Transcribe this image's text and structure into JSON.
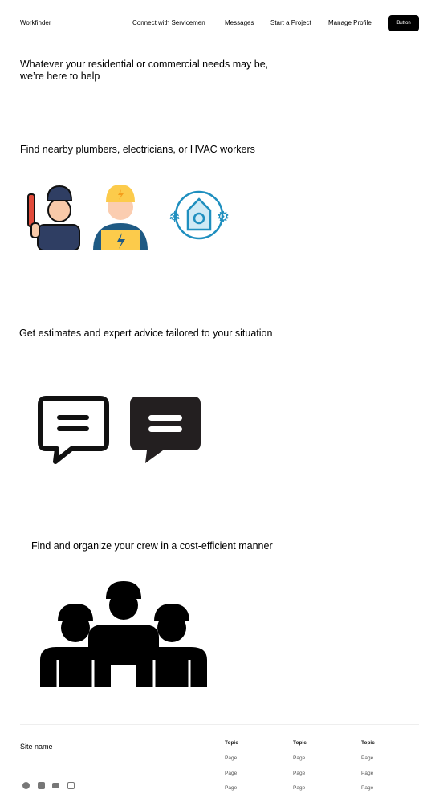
{
  "header": {
    "brand": "Workfinder",
    "nav": [
      "Connect with Servicemen",
      "Messages",
      "Start a Project",
      "Manage Profile"
    ],
    "button_label": "Button"
  },
  "hero": {
    "line1": "Whatever your residential or commercial needs may be,",
    "line2": "we’re here to help"
  },
  "sections": [
    {
      "title": "Find nearby plumbers, electricians, or HVAC workers",
      "icons": [
        "plumber-icon",
        "electrician-icon",
        "hvac-icon"
      ]
    },
    {
      "title": "Get estimates and expert advice tailored to your situation",
      "icons": [
        "chat-bubble-outline-icon",
        "chat-bubble-filled-icon"
      ]
    },
    {
      "title": "Find and organize your crew in a cost-efficient manner",
      "icons": [
        "crew-icon"
      ]
    }
  ],
  "footer": {
    "site_name": "Site name",
    "columns": [
      {
        "topic": "Topic",
        "pages": [
          "Page",
          "Page",
          "Page"
        ]
      },
      {
        "topic": "Topic",
        "pages": [
          "Page",
          "Page",
          "Page"
        ]
      },
      {
        "topic": "Topic",
        "pages": [
          "Page",
          "Page",
          "Page"
        ]
      }
    ],
    "social": [
      "facebook-icon",
      "linkedin-icon",
      "youtube-icon",
      "instagram-icon"
    ]
  }
}
